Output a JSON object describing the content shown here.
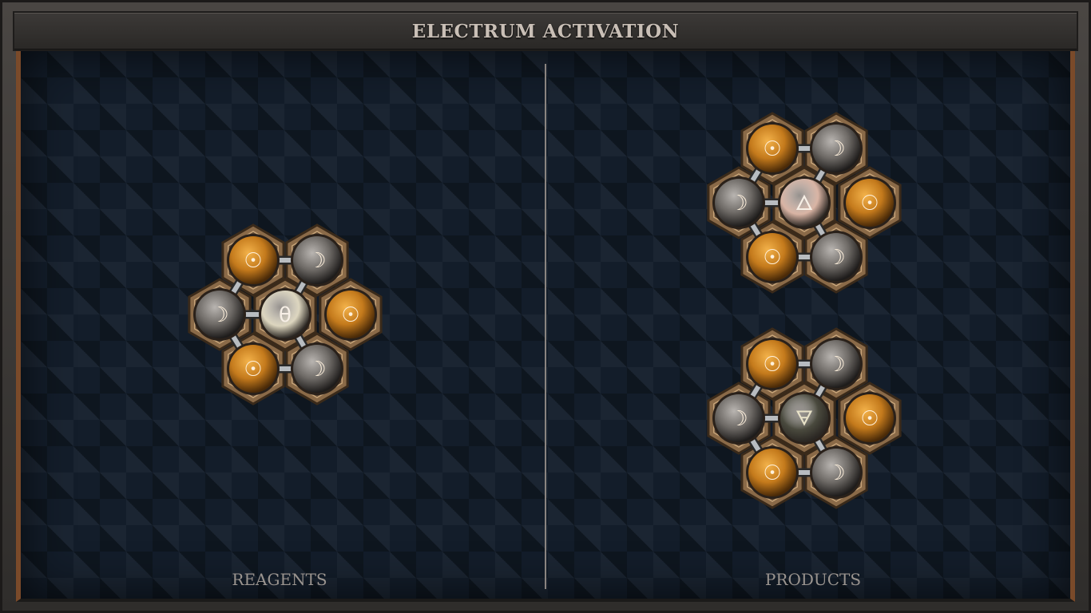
{
  "title": "ELECTRUM ACTIVATION",
  "panels": {
    "reagents_label": "REAGENTS",
    "products_label": "PRODUCTS"
  },
  "molecules": [
    {
      "name": "reagent-molecule",
      "center_atom": {
        "element": "quicksilver",
        "glyph": "θ",
        "color": "#ddd6bf"
      },
      "ring": [
        {
          "element": "gold",
          "glyph": "☉"
        },
        {
          "element": "silver",
          "glyph": "☽"
        },
        {
          "element": "gold",
          "glyph": "☉"
        },
        {
          "element": "silver",
          "glyph": "☽"
        },
        {
          "element": "gold",
          "glyph": "☉"
        },
        {
          "element": "silver",
          "glyph": "☽"
        }
      ]
    },
    {
      "name": "product-molecule-top",
      "center_atom": {
        "element": "fire-salt",
        "glyph": "🜂",
        "color": "#d9b4a4"
      },
      "ring": [
        {
          "element": "gold",
          "glyph": "☉"
        },
        {
          "element": "silver",
          "glyph": "☽"
        },
        {
          "element": "gold",
          "glyph": "☉"
        },
        {
          "element": "silver",
          "glyph": "☽"
        },
        {
          "element": "gold",
          "glyph": "☉"
        },
        {
          "element": "silver",
          "glyph": "☽"
        }
      ]
    },
    {
      "name": "product-molecule-bottom",
      "center_atom": {
        "element": "earth-salt",
        "glyph": "🜃",
        "color": "#4a4a3e"
      },
      "ring": [
        {
          "element": "gold",
          "glyph": "☉"
        },
        {
          "element": "silver",
          "glyph": "☽"
        },
        {
          "element": "gold",
          "glyph": "☉"
        },
        {
          "element": "silver",
          "glyph": "☽"
        },
        {
          "element": "gold",
          "glyph": "☉"
        },
        {
          "element": "silver",
          "glyph": "☽"
        }
      ]
    }
  ],
  "colors": {
    "gold_atom": "#c47a1c",
    "silver_atom": "#6e6a66",
    "bond": "#b8bcc0",
    "hex_plate": "#8a6a48",
    "board": "#131d2a"
  }
}
